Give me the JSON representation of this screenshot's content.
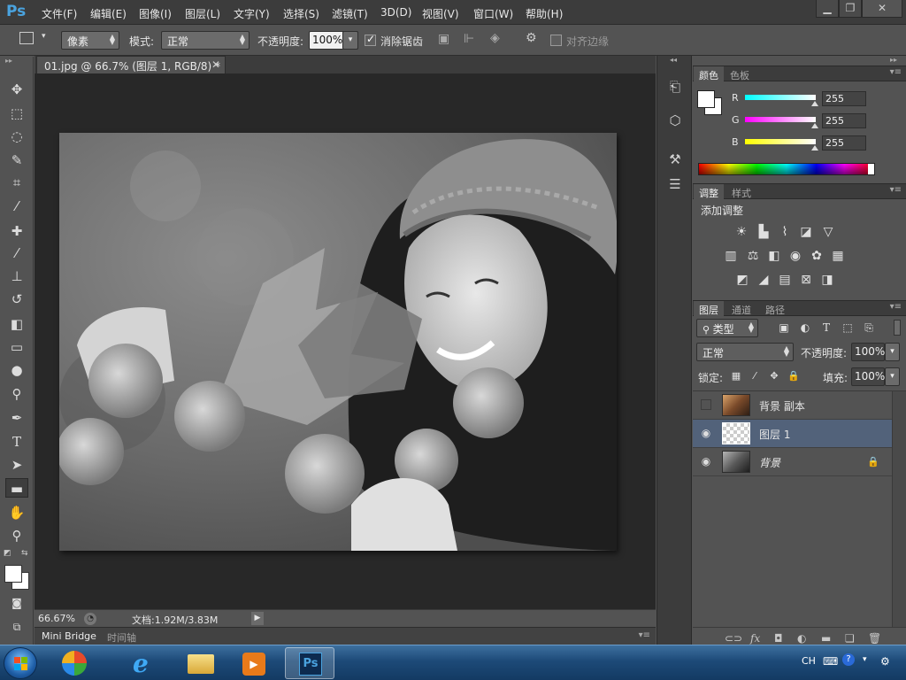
{
  "app": {
    "logo": "Ps",
    "menu": [
      "文件(F)",
      "编辑(E)",
      "图像(I)",
      "图层(L)",
      "文字(Y)",
      "选择(S)",
      "滤镜(T)",
      "3D(D)",
      "视图(V)",
      "窗口(W)",
      "帮助(H)"
    ],
    "window_controls": [
      "minimize-icon",
      "restore-icon",
      "close-icon"
    ]
  },
  "options": {
    "unit": "像素",
    "mode_label": "模式:",
    "mode_value": "正常",
    "opacity_label": "不透明度:",
    "opacity_value": "100%",
    "antialias_label": "消除锯齿",
    "antialias_checked": true,
    "align_edges_label": "对齐边缘",
    "align_edges_checked": false
  },
  "tools": [
    "move-tool-icon",
    "marquee-tool-icon",
    "lasso-tool-icon",
    "quick-selection-icon",
    "crop-tool-icon",
    "eyedropper-icon",
    "healing-brush-icon",
    "brush-tool-icon",
    "clone-stamp-icon",
    "history-brush-icon",
    "eraser-icon",
    "gradient-tool-icon",
    "blur-tool-icon",
    "dodge-tool-icon",
    "pen-tool-icon",
    "type-tool-icon",
    "path-selection-icon",
    "rectangle-tool-icon",
    "hand-tool-icon",
    "zoom-tool-icon"
  ],
  "document": {
    "tab_title": "01.jpg @ 66.7% (图层 1, RGB/8) *",
    "zoom": "66.67%",
    "doc_info": "文档:1.92M/3.83M",
    "bottom_tabs": [
      "Mini Bridge",
      "时间轴"
    ]
  },
  "color_panel": {
    "tabs": [
      "颜色",
      "色板"
    ],
    "foreground": "#ffffff",
    "background": "#ffffff",
    "channels": [
      {
        "label": "R",
        "value": "255",
        "from": "#00ffff",
        "to": "#ffffff"
      },
      {
        "label": "G",
        "value": "255",
        "from": "#ff00ff",
        "to": "#ffffff"
      },
      {
        "label": "B",
        "value": "255",
        "from": "#ffff00",
        "to": "#ffffff"
      }
    ]
  },
  "adjustments_panel": {
    "tabs": [
      "调整",
      "样式"
    ],
    "title": "添加调整"
  },
  "layers_panel": {
    "tabs": [
      "图层",
      "通道",
      "路径"
    ],
    "filter_label": "类型",
    "blend_mode": "正常",
    "opacity_label": "不透明度:",
    "opacity_value": "100%",
    "lock_label": "锁定:",
    "fill_label": "填充:",
    "fill_value": "100%",
    "layers": [
      {
        "name": "背景 副本",
        "visible": false,
        "selected": false,
        "thumb": "photo",
        "locked": false,
        "italic": false
      },
      {
        "name": "图层 1",
        "visible": true,
        "selected": true,
        "thumb": "transparent",
        "locked": false,
        "italic": false
      },
      {
        "name": "背景",
        "visible": true,
        "selected": false,
        "thumb": "photo-gray",
        "locked": true,
        "italic": true
      }
    ]
  },
  "taskbar": {
    "apps": [
      "start-orb-icon",
      "media-center-icon",
      "internet-explorer-icon",
      "explorer-folder-icon",
      "media-player-icon",
      "photoshop-icon"
    ],
    "active_app": "photoshop-icon",
    "lang": "CH"
  }
}
